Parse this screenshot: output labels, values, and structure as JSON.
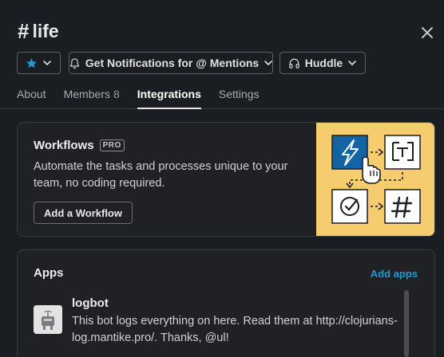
{
  "channel": {
    "hash": "#",
    "name": "life"
  },
  "buttons": {
    "star_icon": "star-icon",
    "notifications_label": "Get Notifications for @ Mentions",
    "huddle_label": "Huddle"
  },
  "tabs": [
    {
      "label": "About"
    },
    {
      "label": "Members",
      "count": "8"
    },
    {
      "label": "Integrations",
      "active": true
    },
    {
      "label": "Settings"
    }
  ],
  "workflows": {
    "title": "Workflows",
    "badge": "PRO",
    "description": "Automate the tasks and processes unique to your team, no coding required.",
    "button_label": "Add a Workflow"
  },
  "apps": {
    "title": "Apps",
    "add_label": "Add apps",
    "items": [
      {
        "name": "logbot",
        "description": "This bot logs everything on here. Read them at http://clojurians-log.mantike.pro/. Thanks, @ul!"
      }
    ]
  },
  "colors": {
    "accent_blue": "#1d9bd1",
    "star_blue": "#1d9bd1",
    "illustration_bg": "#f6cd6e",
    "background": "#1a1d21"
  }
}
